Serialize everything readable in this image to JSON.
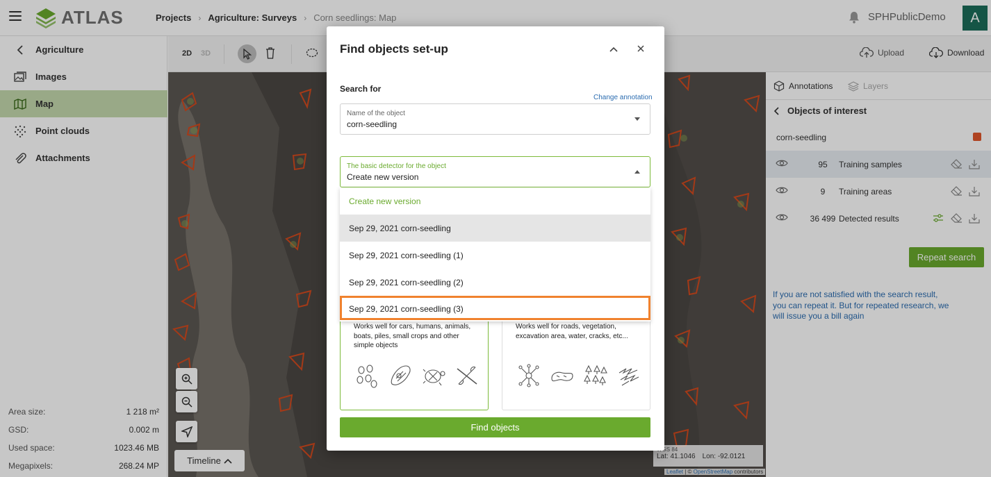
{
  "header": {
    "logo_text": "ATLAS",
    "breadcrumb": [
      "Projects",
      "Agriculture: Surveys",
      "Corn seedlings: Map"
    ],
    "user_name": "SPHPublicDemo",
    "avatar_letter": "A"
  },
  "sidebar": {
    "back_label": "Agriculture",
    "items": [
      {
        "label": "Images",
        "icon": "images-icon"
      },
      {
        "label": "Map",
        "icon": "map-icon",
        "active": true
      },
      {
        "label": "Point clouds",
        "icon": "point-cloud-icon"
      },
      {
        "label": "Attachments",
        "icon": "paperclip-icon"
      }
    ],
    "stats": [
      {
        "label": "Area size:",
        "value": "1 218 m²"
      },
      {
        "label": "GSD:",
        "value": "0.002 m"
      },
      {
        "label": "Used space:",
        "value": "1023.46 MB"
      },
      {
        "label": "Megapixels:",
        "value": "268.24 MP"
      }
    ]
  },
  "toolbar": {
    "mode_2d": "2D",
    "mode_3d": "3D",
    "upload_label": "Upload",
    "download_label": "Download"
  },
  "map": {
    "timeline_label": "Timeline",
    "coords_crs": "WGS 84",
    "lat": "Lat: 41.1046",
    "lon": "Lon: -92.0121",
    "attribution_leaflet": "Leaflet",
    "attribution_sep": " | © ",
    "attribution_osm": "OpenStreetMap",
    "attribution_tail": " contributors"
  },
  "right_panel": {
    "tab_annotations": "Annotations",
    "tab_layers": "Layers",
    "back_title": "Objects of interest",
    "class_name": "corn-seedling",
    "class_color": "#e0572b",
    "rows": [
      {
        "count": "95",
        "label": "Training samples"
      },
      {
        "count": "9",
        "label": "Training areas"
      },
      {
        "count": "36 499",
        "label": "Detected results"
      }
    ],
    "repeat_label": "Repeat search",
    "note": "If you are not satisfied with the search result, you can repeat it. But for repeated research, we will issue you a bill again"
  },
  "modal": {
    "title": "Find objects set-up",
    "search_for": "Search for",
    "change_annotation": "Change annotation",
    "object_field_label": "Name of the object",
    "object_field_value": "corn-seedling",
    "detector_field_label": "The basic detector for the object",
    "detector_field_value": "Create new version",
    "options": [
      "Create new version",
      "Sep 29, 2021 corn-seedling",
      "Sep 29, 2021 corn-seedling (1)",
      "Sep 29, 2021 corn-seedling (2)",
      "Sep 29, 2021 corn-seedling (3)"
    ],
    "card_simple_desc": "Works well for cars, humans, animals, boats, piles, small crops and other simple objects",
    "card_complex_desc": "Works well for roads, vegetation, excavation area, water, cracks, etc...",
    "find_label": "Find objects"
  },
  "colors": {
    "accent_green": "#6aaa2e",
    "highlight_orange": "#f0822e",
    "link_blue": "#2b6cb0",
    "avatar_bg": "#1b6e5a"
  }
}
